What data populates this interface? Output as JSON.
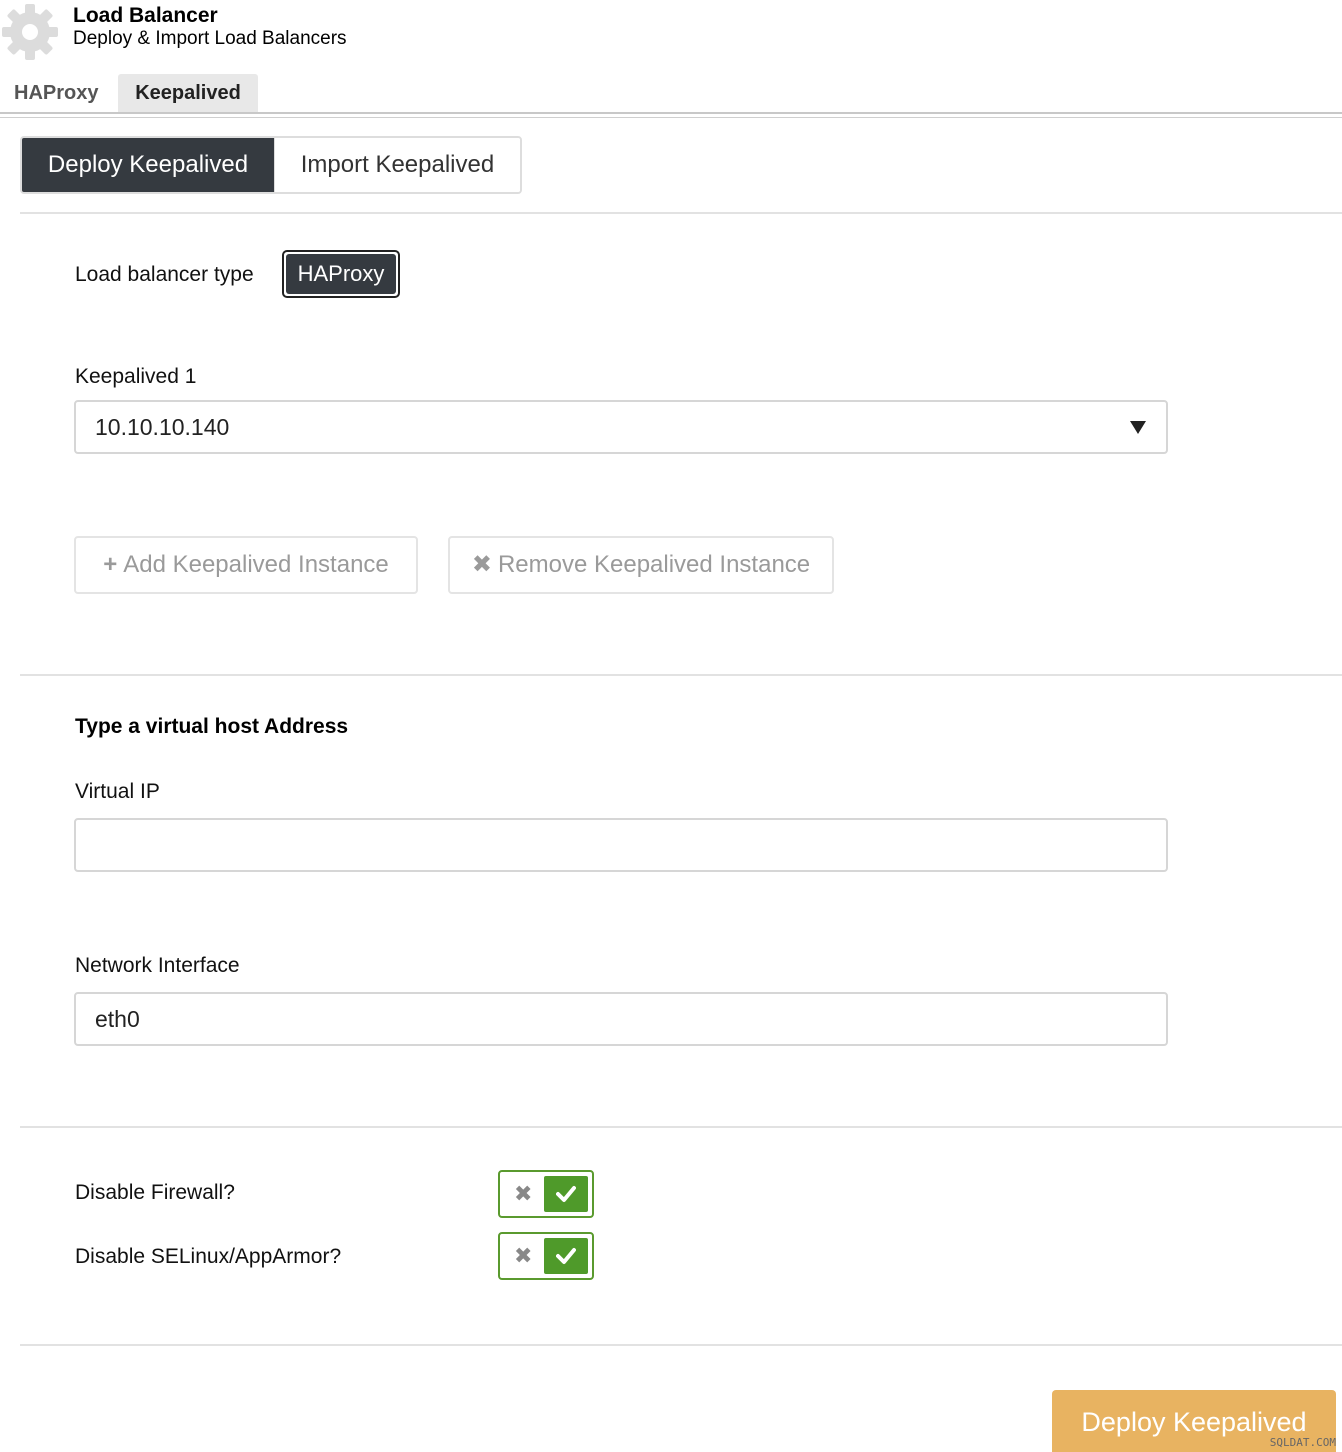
{
  "header": {
    "icon": "gear-icon",
    "title": "Load Balancer",
    "subtitle": "Deploy & Import Load Balancers"
  },
  "tabs": [
    {
      "label": "HAProxy",
      "active": false
    },
    {
      "label": "Keepalived",
      "active": true
    }
  ],
  "mode": {
    "deploy_label": "Deploy Keepalived",
    "import_label": "Import Keepalived"
  },
  "lb_type": {
    "label": "Load balancer type",
    "value": "HAProxy"
  },
  "keepalived1": {
    "label": "Keepalived 1",
    "selected": "10.10.10.140"
  },
  "instances": {
    "add_label": "Add Keepalived Instance",
    "remove_label": "Remove Keepalived Instance"
  },
  "virtual_host": {
    "section_title": "Type a virtual host Address",
    "vip_label": "Virtual IP",
    "vip_value": "",
    "iface_label": "Network Interface",
    "iface_value": "eth0"
  },
  "options": {
    "firewall_label": "Disable Firewall?",
    "firewall_on": true,
    "selinux_label": "Disable SELinux/AppArmor?",
    "selinux_on": true
  },
  "footer": {
    "deploy_button": "Deploy Keepalived",
    "watermark": "SQLDAT.COM"
  },
  "colors": {
    "dark": "#353a40",
    "toggle_green": "#4f9a2a",
    "deploy_orange": "#e8b361"
  }
}
